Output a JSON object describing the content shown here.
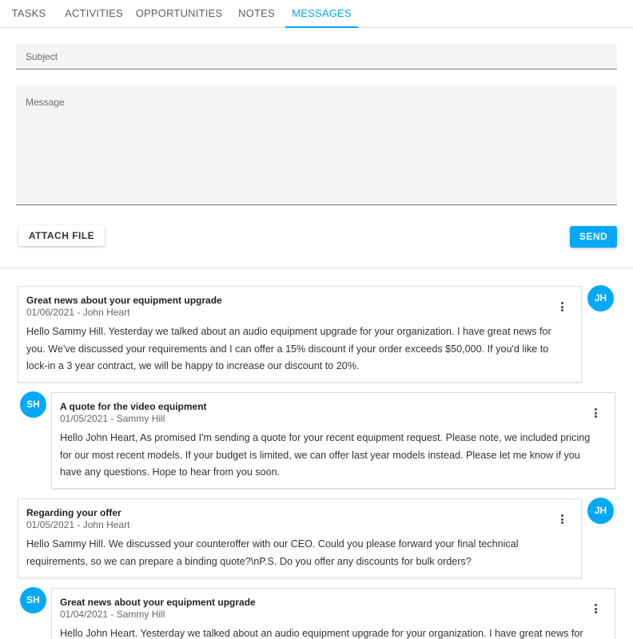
{
  "tabs": [
    {
      "label": "TASKS"
    },
    {
      "label": "ACTIVITIES"
    },
    {
      "label": "OPPORTUNITIES"
    },
    {
      "label": "NOTES"
    },
    {
      "label": "MESSAGES"
    }
  ],
  "compose": {
    "subject_placeholder": "Subject",
    "message_placeholder": "Message",
    "attach_label": "ATTACH FILE",
    "send_label": "SEND"
  },
  "messages": [
    {
      "title": "Great news about your equipment upgrade",
      "meta": "01/06/2021 - John Heart",
      "body": "Hello Sammy Hill. Yesterday we talked about an audio equipment upgrade for your organization. I have great news for you. We've discussed your requirements and I can offer a 15% discount if your order exceeds $50,000. If you'd like to lock-in a 3 year contract, we will be happy to increase our discount to 20%.",
      "initials": "JH"
    },
    {
      "title": "A quote for the video equipment",
      "meta": "01/05/2021 - Sammy Hill",
      "body": "Hello John Heart, As promised I'm sending a quote for your recent equipment request. Please note, we included pricing for our most recent models. If your budget is limited, we can offer last year models instead. Please let me know if you have any questions. Hope to hear from you soon.",
      "initials": "SH"
    },
    {
      "title": "Regarding your offer",
      "meta": "01/05/2021 - John Heart",
      "body": "Hello Sammy Hill. We discussed your counteroffer with our CEO. Could you please forward your final technical requirements, so we can prepare a binding quote?\\nP.S. Do you offer any discounts for bulk orders?",
      "initials": "JH"
    },
    {
      "title": "Great news about your equipment upgrade",
      "meta": "01/04/2021 - Sammy Hill",
      "body": "Hello John Heart. Yesterday we talked about an audio equipment upgrade for your organization. I have great news for",
      "initials": "SH"
    }
  ],
  "colors": {
    "accent": "#03a9f4"
  }
}
